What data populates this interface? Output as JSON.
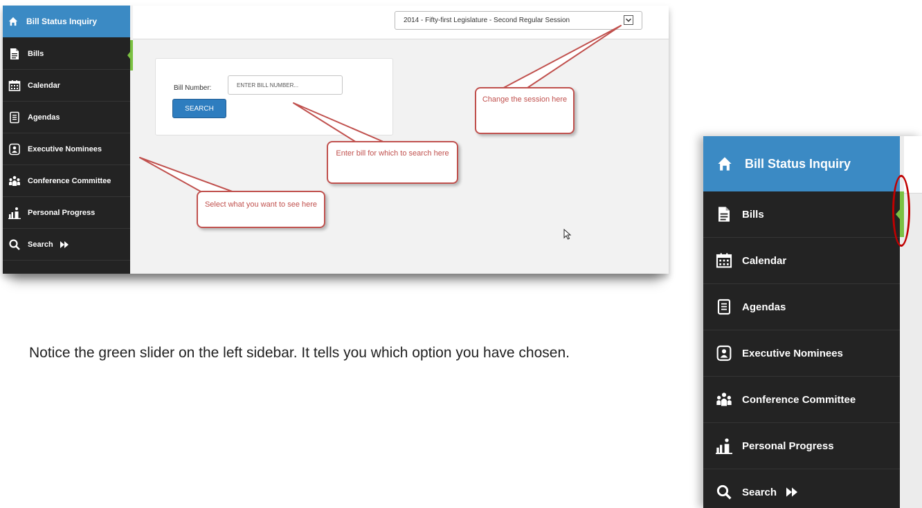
{
  "screenshot1": {
    "app_title": "Bill Status Inquiry",
    "sidebar": {
      "items": [
        {
          "label": "Bills",
          "icon": "document-icon"
        },
        {
          "label": "Calendar",
          "icon": "calendar-icon"
        },
        {
          "label": "Agendas",
          "icon": "agenda-icon"
        },
        {
          "label": "Executive Nominees",
          "icon": "nominees-icon"
        },
        {
          "label": "Conference Committee",
          "icon": "committee-icon"
        },
        {
          "label": "Personal Progress",
          "icon": "progress-icon"
        },
        {
          "label": "Search",
          "icon": "search-icon"
        }
      ]
    },
    "session": {
      "selected": "2014 - Fifty-first Legislature - Second Regular Session"
    },
    "bill_search": {
      "label": "Bill Number:",
      "placeholder": "ENTER BILL NUMBER...",
      "button": "SEARCH"
    },
    "callouts": {
      "session": "Change the session here",
      "bill": "Enter bill for which to search here",
      "sidebar": "Select what you want to see here"
    }
  },
  "screenshot2": {
    "app_title": "Bill Status Inquiry",
    "sidebar": {
      "items": [
        {
          "label": "Bills",
          "icon": "document-icon"
        },
        {
          "label": "Calendar",
          "icon": "calendar-icon"
        },
        {
          "label": "Agendas",
          "icon": "agenda-icon"
        },
        {
          "label": "Executive Nominees",
          "icon": "nominees-icon"
        },
        {
          "label": "Conference Committee",
          "icon": "committee-icon"
        },
        {
          "label": "Personal Progress",
          "icon": "progress-icon"
        },
        {
          "label": "Search",
          "icon": "search-icon"
        }
      ]
    }
  },
  "note": "Notice the green slider on the left sidebar.  It tells you which option you have chosen.",
  "colors": {
    "sidebar_bg": "#232323",
    "header_blue": "#3b8ac4",
    "slider_green": "#7bc142",
    "button_blue": "#2e7dbf",
    "callout_red": "#c0504d",
    "highlight_red": "#c00000"
  }
}
